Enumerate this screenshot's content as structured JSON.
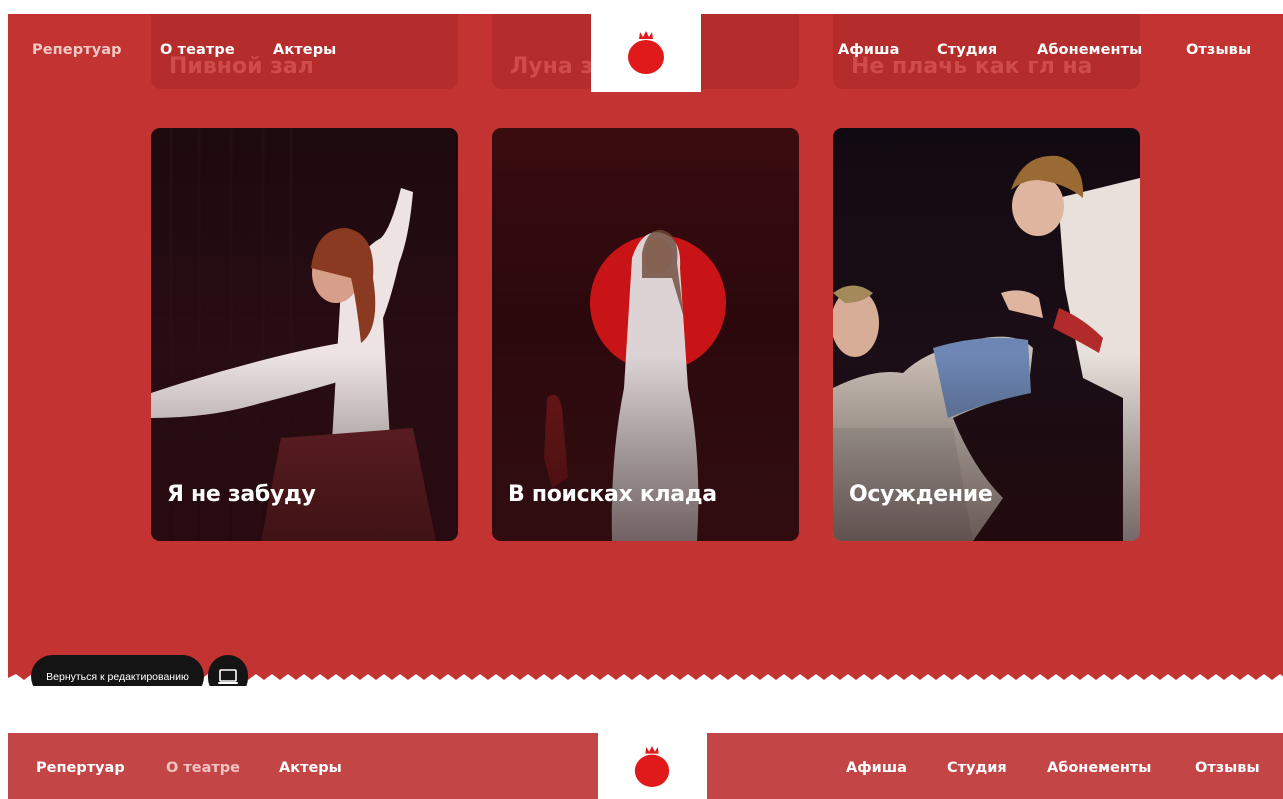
{
  "colors": {
    "brand_red": "#c23331",
    "header_red": "#c44546",
    "logo_red": "#e0191b",
    "pill_dark": "#141414"
  },
  "ghost_cards": [
    "Пивной зал",
    "Луна з",
    "Не плачь как гл на"
  ],
  "nav": {
    "left": [
      "Репертуар",
      "О театре",
      "Актеры"
    ],
    "right": [
      "Афиша",
      "Студия",
      "Абонементы",
      "Отзывы"
    ],
    "logo_icon": "pomegranate-icon"
  },
  "cards": [
    {
      "title": "Я не забуду"
    },
    {
      "title": "В поисках клада"
    },
    {
      "title": "Осуждение"
    }
  ],
  "editor": {
    "return_label": "Вернуться к редактированию",
    "device_icon": "laptop-icon"
  },
  "header_bottom": {
    "left": [
      "Репертуар",
      "О театре",
      "Актеры"
    ],
    "right": [
      "Афиша",
      "Студия",
      "Абонементы",
      "Отзывы"
    ],
    "logo_icon": "pomegranate-icon"
  }
}
